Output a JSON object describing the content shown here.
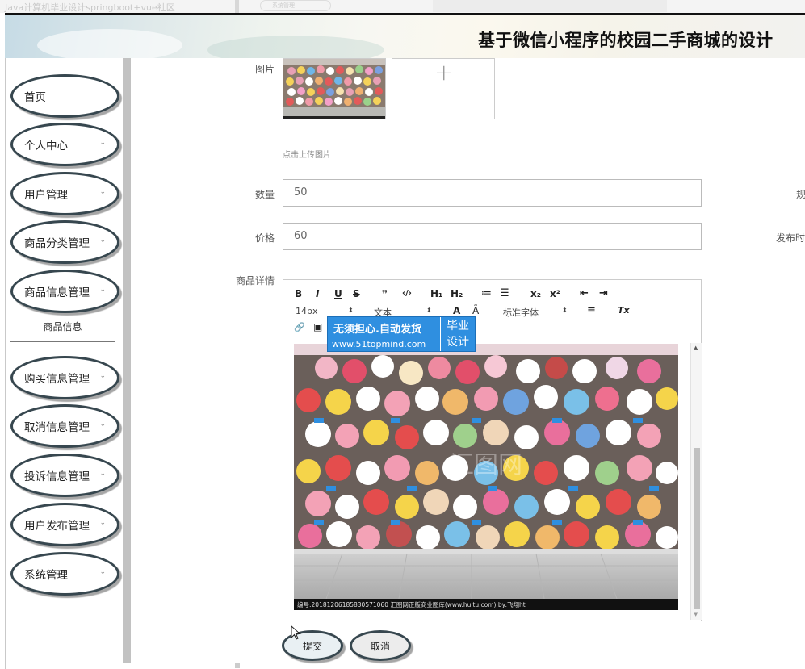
{
  "background": {
    "faded_text": "Java计算机毕业设计springboot+vue社区",
    "faded_pill": "系统管理"
  },
  "header": {
    "title": "基于微信小程序的校园二手商城的设计"
  },
  "sidebar": {
    "items": [
      {
        "label": "首页",
        "has_chevron": false
      },
      {
        "label": "个人中心",
        "has_chevron": true
      },
      {
        "label": "用户管理",
        "has_chevron": true
      },
      {
        "label": "商品分类管理",
        "has_chevron": true
      },
      {
        "label": "商品信息管理",
        "has_chevron": true
      },
      {
        "label": "购买信息管理",
        "has_chevron": true
      },
      {
        "label": "取消信息管理",
        "has_chevron": true
      },
      {
        "label": "投诉信息管理",
        "has_chevron": true
      },
      {
        "label": "用户发布管理",
        "has_chevron": true
      },
      {
        "label": "系统管理",
        "has_chevron": true
      }
    ],
    "subitem": "商品信息",
    "chevron": "⌄"
  },
  "form": {
    "image_label": "图片",
    "upload_hint": "点击上传图片",
    "upload_plus": "+",
    "quantity_label": "数量",
    "quantity_value": "50",
    "price_label": "价格",
    "price_value": "60",
    "detail_label": "商品详情",
    "right_cut_1": "规",
    "right_cut_2": "发布时",
    "image_caption": "编号:20181206185830571060  汇图网正版商业图库(www.huitu.com)  by:飞翔ht",
    "watermark_text": "汇图网"
  },
  "editor": {
    "toolbar_row1": [
      "B",
      "I",
      "U",
      "S",
      "❞",
      "‹/›",
      "H₁",
      "H₂",
      "≔",
      "☰",
      "x₂",
      "x²",
      "⇤",
      "⇥"
    ],
    "font_size": "14px",
    "text_style": "文本",
    "font_family": "标准字体",
    "color_icon": "A",
    "highlight_icon": "Ã",
    "align_icon": "≡",
    "clear_icon": "Tx",
    "link_icon": "🔗",
    "image_icon": "▣",
    "select_arrow": "⬍"
  },
  "ad": {
    "line1": "无须担心.自动发货",
    "line2": "www.51topmind.com",
    "right1": "毕业",
    "right2": "设计"
  },
  "buttons": {
    "submit": "提交",
    "cancel": "取消"
  },
  "colors": {
    "ad_blue": "#2f8fe0",
    "pill_border": "#37474f"
  }
}
